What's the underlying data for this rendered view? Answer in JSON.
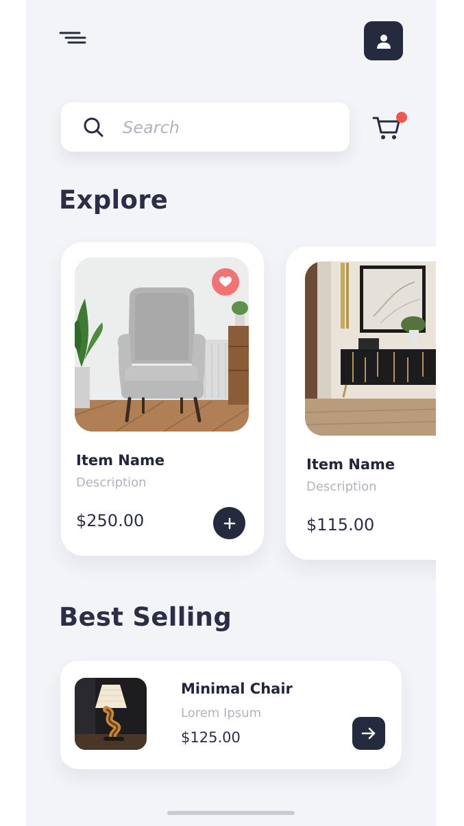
{
  "header": {
    "menu_icon": "hamburger-menu-icon",
    "profile_icon": "user-icon"
  },
  "search": {
    "placeholder": "Search",
    "icon": "search-icon"
  },
  "cart": {
    "icon": "cart-icon",
    "has_notification": true,
    "notification_color": "#f0584f"
  },
  "explore": {
    "title": "Explore",
    "items": [
      {
        "name": "Item Name",
        "description": "Description",
        "price": "$250.00",
        "favorite": true
      },
      {
        "name": "Item Name",
        "description": "Description",
        "price": "$115.00"
      }
    ]
  },
  "best_selling": {
    "title": "Best Selling",
    "item": {
      "name": "Minimal Chair",
      "subtitle": "Lorem Ipsum",
      "price": "$125.00"
    }
  },
  "colors": {
    "background": "#f3f4f8",
    "primary_dark": "#262a3f",
    "accent_red": "#f27373",
    "muted_text": "#b1b3be"
  }
}
